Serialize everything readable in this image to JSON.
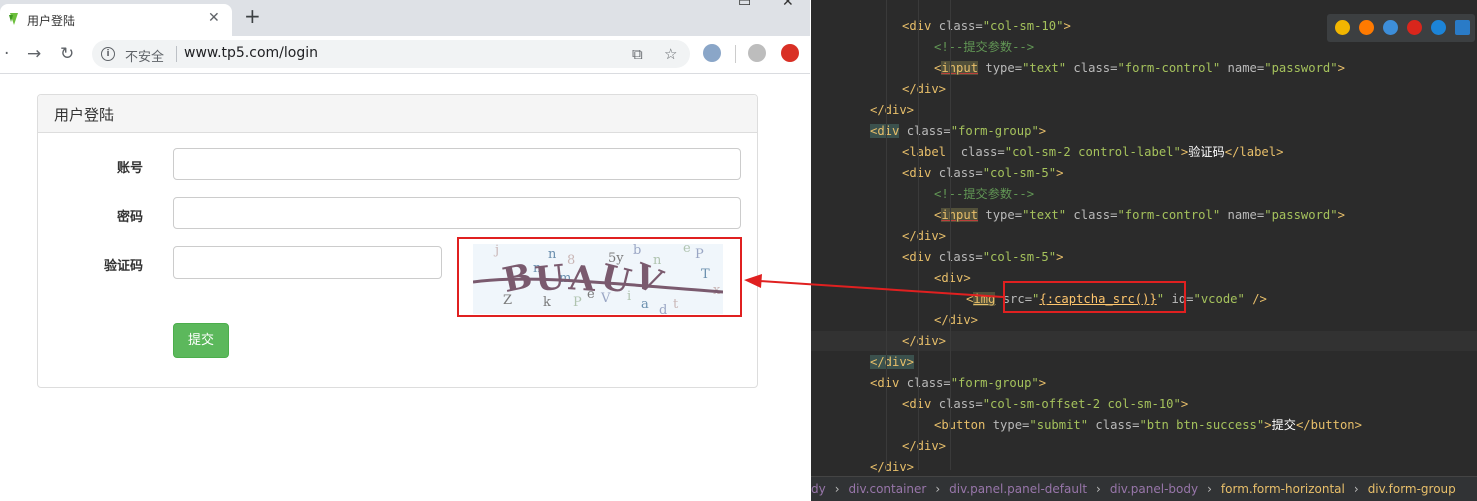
{
  "browser": {
    "tab_title": "用户登陆",
    "tab_close": "✕",
    "new_tab": "+",
    "insecure_label": "不安全",
    "url": "www.tp5.com/login"
  },
  "form": {
    "panel_title": "用户登陆",
    "account_label": "账号",
    "password_label": "密码",
    "captcha_label": "验证码",
    "submit_label": "提交",
    "captcha_text": "BUAUV",
    "captcha_noise": [
      "n",
      "8",
      "5y",
      "n",
      "P",
      "T",
      "j",
      "k",
      "P",
      "V",
      "a",
      "t",
      "e",
      "i",
      "d",
      "m",
      "x",
      "Z",
      "e",
      "b",
      "n"
    ]
  },
  "editor": {
    "lines": [
      {
        "indent": 3,
        "html": "<span class='tag'>&lt;div </span><span class='attr'>class=</span><span class='val'>\"col-sm-10\"</span><span class='tag'>&gt;</span>"
      },
      {
        "indent": 4,
        "html": "<span class='cmt'>&lt;!--提交参数--&gt;</span>"
      },
      {
        "indent": 4,
        "html": "<span class='tag'>&lt;</span><span class='inp'>input</span><span class='attr'> type=</span><span class='val'>\"text\"</span><span class='attr'> class=</span><span class='val'>\"form-control\"</span><span class='attr'> name=</span><span class='val'>\"password\"</span><span class='tag'>&gt;</span>"
      },
      {
        "indent": 3,
        "html": "<span class='tag'>&lt;/div&gt;</span>"
      },
      {
        "indent": 2,
        "html": "<span class='tag'>&lt;/div&gt;</span>"
      },
      {
        "indent": 2,
        "html": "<span class='tagh'>&lt;div</span><span class='attr'> class=</span><span class='val'>\"form-group\"</span><span class='tag'>&gt;</span>"
      },
      {
        "indent": 3,
        "html": "<span class='tag'>&lt;label  </span><span class='attr'>class=</span><span class='val'>\"col-sm-2 control-label\"</span><span class='tag'>&gt;</span><span class='txt'>验证码</span><span class='tag'>&lt;/label&gt;</span>"
      },
      {
        "indent": 3,
        "html": "<span class='tag'>&lt;div </span><span class='attr'>class=</span><span class='val'>\"col-sm-5\"</span><span class='tag'>&gt;</span>"
      },
      {
        "indent": 4,
        "html": "<span class='cmt'>&lt;!--提交参数--&gt;</span>"
      },
      {
        "indent": 4,
        "html": "<span class='tag'>&lt;</span><span class='inp'>input</span><span class='attr'> type=</span><span class='val'>\"text\"</span><span class='attr'> class=</span><span class='val'>\"form-control\"</span><span class='attr'> name=</span><span class='val'>\"password\"</span><span class='tag'>&gt;</span>"
      },
      {
        "indent": 3,
        "html": "<span class='tag'>&lt;/div&gt;</span>"
      },
      {
        "indent": 3,
        "html": "<span class='tag'>&lt;div </span><span class='attr'>class=</span><span class='val'>\"col-sm-5\"</span><span class='tag'>&gt;</span>"
      },
      {
        "indent": 4,
        "html": "<span class='tag'>&lt;div&gt;</span>"
      },
      {
        "indent": 5,
        "html": "<span class='tag'>&lt;</span><span class='img'>img</span><span class='attr'> src=</span><span class='val'>\"</span><span class='tpl'>{:captcha_src()}</span><span class='val'>\"</span><span class='attr'> id=</span><span class='val'>\"vcode\"</span><span class='tag'> /&gt;</span>"
      },
      {
        "indent": 4,
        "html": "<span class='tag'>&lt;/div&gt;</span>"
      },
      {
        "indent": 3,
        "html": "<span class='tag'>&lt;/div&gt;</span>"
      },
      {
        "indent": 2,
        "html": "<span class='tagh'>&lt;/div&gt;</span>"
      },
      {
        "indent": 2,
        "html": "<span class='tag'>&lt;div </span><span class='attr'>class=</span><span class='val'>\"form-group\"</span><span class='tag'>&gt;</span>"
      },
      {
        "indent": 3,
        "html": "<span class='tag'>&lt;div </span><span class='attr'>class=</span><span class='val'>\"col-sm-offset-2 col-sm-10\"</span><span class='tag'>&gt;</span>"
      },
      {
        "indent": 4,
        "html": "<span class='tag'>&lt;button </span><span class='attr'>type=</span><span class='val'>\"submit\"</span><span class='attr'> class=</span><span class='val'>\"btn btn-success\"</span><span class='tag'>&gt;</span><span class='txt'>提交</span><span class='tag'>&lt;/button&gt;</span>"
      },
      {
        "indent": 3,
        "html": "<span class='tag'>&lt;/div&gt;</span>"
      },
      {
        "indent": 2,
        "html": "<span class='tag'>&lt;/div&gt;</span>"
      }
    ],
    "breadcrumb": [
      "dy",
      "div.container",
      "div.panel.panel-default",
      "div.panel-body",
      "form.form-horizontal",
      "div.form-group"
    ]
  }
}
